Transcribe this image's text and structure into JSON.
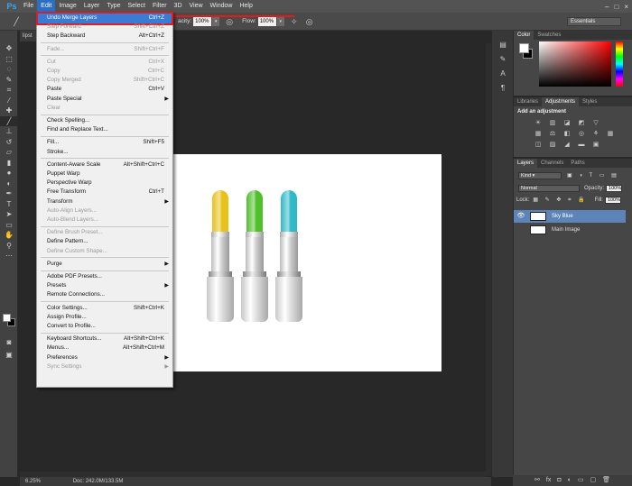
{
  "app": {
    "logo": "Ps"
  },
  "menubar": [
    "File",
    "Edit",
    "Image",
    "Layer",
    "Type",
    "Select",
    "Filter",
    "3D",
    "View",
    "Window",
    "Help"
  ],
  "window_controls": [
    "–",
    "□",
    "×"
  ],
  "options_bar": {
    "opacity_label": "acity:",
    "opacity_value": "100%",
    "flow_label": "Flow:",
    "flow_value": "100%",
    "workspace": "Essentials"
  },
  "doc_tab": "lipst",
  "status": {
    "zoom": "6.25%",
    "doc": "Doc: 242.0M/133.5M"
  },
  "edit_menu": [
    {
      "label": "Undo Merge Layers",
      "shortcut": "Ctrl+Z",
      "state": "highlighted"
    },
    {
      "label": "Step Forward",
      "shortcut": "Shift+Ctrl+Z",
      "state": "disabled"
    },
    {
      "label": "Step Backward",
      "shortcut": "Alt+Ctrl+Z",
      "state": "enabled"
    },
    {
      "sep": true
    },
    {
      "label": "Fade...",
      "shortcut": "Shift+Ctrl+F",
      "state": "disabled"
    },
    {
      "sep": true
    },
    {
      "label": "Cut",
      "shortcut": "Ctrl+X",
      "state": "disabled"
    },
    {
      "label": "Copy",
      "shortcut": "Ctrl+C",
      "state": "disabled"
    },
    {
      "label": "Copy Merged",
      "shortcut": "Shift+Ctrl+C",
      "state": "disabled"
    },
    {
      "label": "Paste",
      "shortcut": "Ctrl+V",
      "state": "enabled"
    },
    {
      "label": "Paste Special",
      "shortcut": "",
      "state": "enabled",
      "submenu": true
    },
    {
      "label": "Clear",
      "shortcut": "",
      "state": "disabled"
    },
    {
      "sep": true
    },
    {
      "label": "Check Spelling...",
      "shortcut": "",
      "state": "enabled"
    },
    {
      "label": "Find and Replace Text...",
      "shortcut": "",
      "state": "enabled"
    },
    {
      "sep": true
    },
    {
      "label": "Fill...",
      "shortcut": "Shift+F5",
      "state": "enabled"
    },
    {
      "label": "Stroke...",
      "shortcut": "",
      "state": "enabled"
    },
    {
      "sep": true
    },
    {
      "label": "Content-Aware Scale",
      "shortcut": "Alt+Shift+Ctrl+C",
      "state": "enabled"
    },
    {
      "label": "Puppet Warp",
      "shortcut": "",
      "state": "enabled"
    },
    {
      "label": "Perspective Warp",
      "shortcut": "",
      "state": "enabled"
    },
    {
      "label": "Free Transform",
      "shortcut": "Ctrl+T",
      "state": "enabled"
    },
    {
      "label": "Transform",
      "shortcut": "",
      "state": "enabled",
      "submenu": true
    },
    {
      "label": "Auto-Align Layers...",
      "shortcut": "",
      "state": "disabled"
    },
    {
      "label": "Auto-Blend Layers...",
      "shortcut": "",
      "state": "disabled"
    },
    {
      "sep": true
    },
    {
      "label": "Define Brush Preset...",
      "shortcut": "",
      "state": "disabled"
    },
    {
      "label": "Define Pattern...",
      "shortcut": "",
      "state": "enabled"
    },
    {
      "label": "Define Custom Shape...",
      "shortcut": "",
      "state": "disabled"
    },
    {
      "sep": true
    },
    {
      "label": "Purge",
      "shortcut": "",
      "state": "enabled",
      "submenu": true
    },
    {
      "sep": true
    },
    {
      "label": "Adobe PDF Presets...",
      "shortcut": "",
      "state": "enabled"
    },
    {
      "label": "Presets",
      "shortcut": "",
      "state": "enabled",
      "submenu": true
    },
    {
      "label": "Remote Connections...",
      "shortcut": "",
      "state": "enabled"
    },
    {
      "sep": true
    },
    {
      "label": "Color Settings...",
      "shortcut": "Shift+Ctrl+K",
      "state": "enabled"
    },
    {
      "label": "Assign Profile...",
      "shortcut": "",
      "state": "enabled"
    },
    {
      "label": "Convert to Profile...",
      "shortcut": "",
      "state": "enabled"
    },
    {
      "sep": true
    },
    {
      "label": "Keyboard Shortcuts...",
      "shortcut": "Alt+Shift+Ctrl+K",
      "state": "enabled"
    },
    {
      "label": "Menus...",
      "shortcut": "Alt+Shift+Ctrl+M",
      "state": "enabled"
    },
    {
      "label": "Preferences",
      "shortcut": "",
      "state": "enabled",
      "submenu": true
    },
    {
      "label": "Sync Settings",
      "shortcut": "",
      "state": "disabled",
      "submenu": true
    }
  ],
  "panels": {
    "color_tabs": [
      "Color",
      "Swatches"
    ],
    "adjust_tabs": [
      "Libraries",
      "Adjustments",
      "Styles"
    ],
    "adjust_title": "Add an adjustment",
    "layers_tabs": [
      "Layers",
      "Channels",
      "Paths"
    ],
    "kind_label": "Kind",
    "blend_mode": "Normal",
    "opacity_label": "Opacity:",
    "opacity_value": "100%",
    "lock_label": "Lock:",
    "fill_label": "Fill:",
    "fill_value": "100%",
    "layers": [
      {
        "name": "Sky Blue",
        "selected": true,
        "visible": true
      },
      {
        "name": "Main Image",
        "selected": false,
        "visible": false
      }
    ]
  },
  "lipsticks": [
    {
      "name": "yellow",
      "color": "#e8c11a"
    },
    {
      "name": "green",
      "color": "#4fbf2a"
    },
    {
      "name": "blue",
      "color": "#2fb8c8"
    }
  ],
  "accent": "#e11c1c",
  "highlight": "#3a7bd5"
}
